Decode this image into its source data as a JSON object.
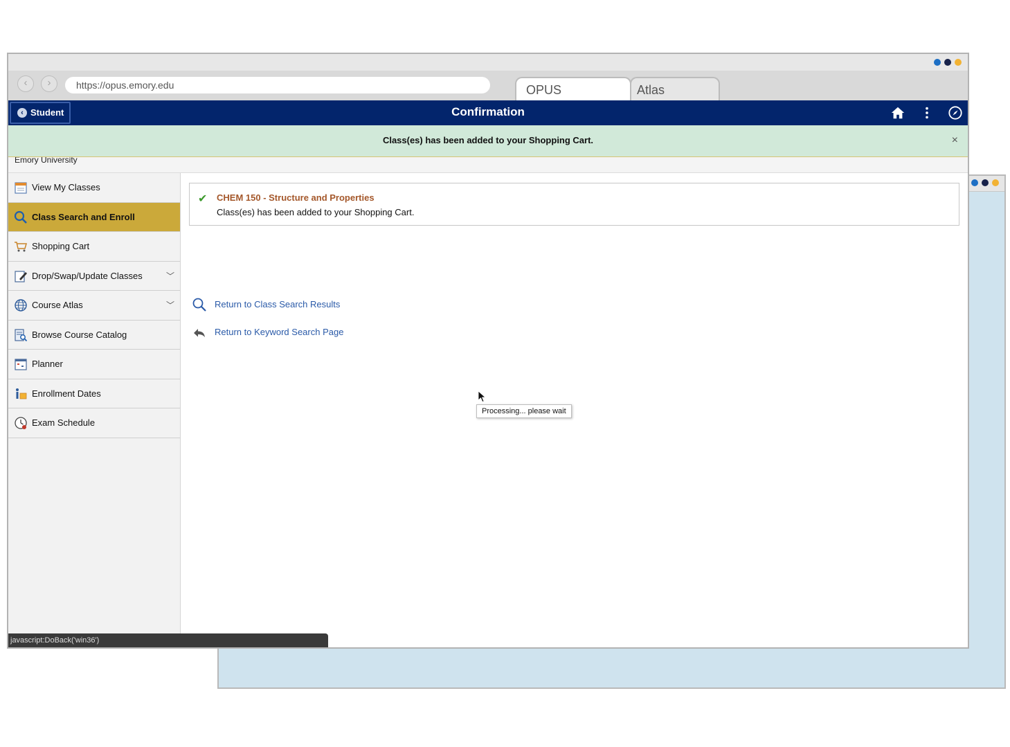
{
  "background_window": {
    "dot_colors": [
      "#1d6fc4",
      "#17224a",
      "#f2b233"
    ]
  },
  "browser": {
    "dot_colors": [
      "#1d6fc4",
      "#17224a",
      "#f2b233"
    ],
    "back_icon": "chevron-left-icon",
    "forward_icon": "chevron-right-icon",
    "url": "https://opus.emory.edu",
    "tabs": [
      {
        "label": "OPUS",
        "active": true
      },
      {
        "label": "Atlas",
        "active": false
      }
    ]
  },
  "header": {
    "back_label": "Student",
    "title": "Confirmation",
    "icons": [
      "home-icon",
      "more-vertical-icon",
      "compass-icon"
    ],
    "color": "#03256c"
  },
  "notice": {
    "text": "Class(es) has been added to your Shopping Cart.",
    "close": "×"
  },
  "org": {
    "name": "Emory University"
  },
  "sidebar": {
    "items": [
      {
        "label": "View My Classes",
        "icon": "calendar-icon",
        "active": false,
        "expandable": false
      },
      {
        "label": "Class Search and Enroll",
        "icon": "search-icon",
        "active": true,
        "expandable": false
      },
      {
        "label": "Shopping Cart",
        "icon": "shopping-cart-icon",
        "active": false,
        "expandable": false
      },
      {
        "label": "Drop/Swap/Update Classes",
        "icon": "edit-document-icon",
        "active": false,
        "expandable": true
      },
      {
        "label": "Course Atlas",
        "icon": "globe-icon",
        "active": false,
        "expandable": true
      },
      {
        "label": "Browse Course Catalog",
        "icon": "catalog-search-icon",
        "active": false,
        "expandable": false
      },
      {
        "label": "Planner",
        "icon": "planner-icon",
        "active": false,
        "expandable": false
      },
      {
        "label": "Enrollment Dates",
        "icon": "enrollment-dates-icon",
        "active": false,
        "expandable": false
      },
      {
        "label": "Exam Schedule",
        "icon": "exam-clock-icon",
        "active": false,
        "expandable": false
      }
    ],
    "active_color": "#cba93a"
  },
  "confirmation": {
    "course": "CHEM  150 - Structure and Properties",
    "message": "Class(es) has been added to your Shopping Cart.",
    "check_color": "#3d9a2d"
  },
  "links": [
    {
      "label": "Return to Class Search Results",
      "icon": "search-icon"
    },
    {
      "label": "Return to Keyword Search Page",
      "icon": "return-arrow-icon"
    }
  ],
  "tooltip": "Processing... please wait",
  "status_bar": "javascript:DoBack('win36')"
}
